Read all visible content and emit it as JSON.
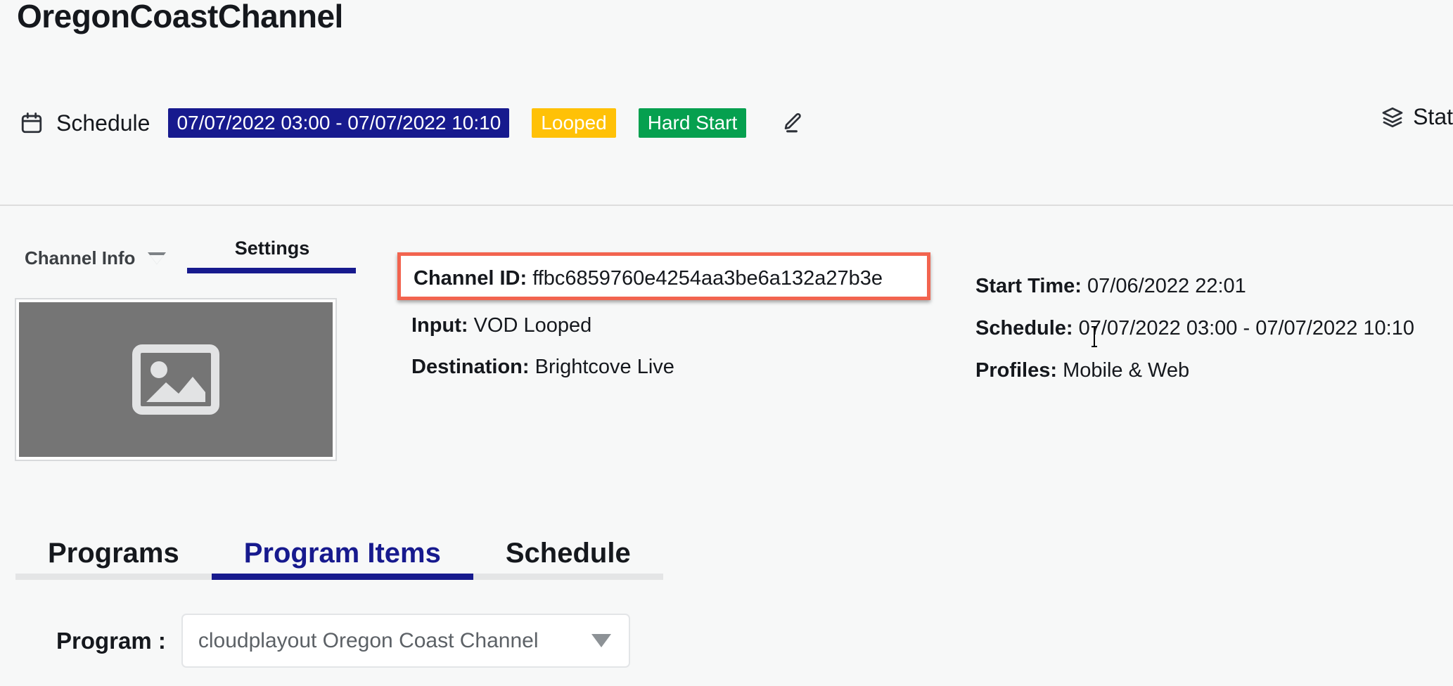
{
  "page": {
    "title": "OregonCoastChannel"
  },
  "header": {
    "calendar_icon": "calendar-icon",
    "schedule_label": "Schedule",
    "schedule_range": "07/07/2022 03:00 - 07/07/2022 10:10",
    "badge_looped": "Looped",
    "badge_hard_start": "Hard Start",
    "edit_icon": "pencil-icon",
    "layers_icon": "layers-icon",
    "status_label": "Stat",
    "colors": {
      "schedule_pill": "#171a8e",
      "looped_badge": "#ffc107",
      "hard_start_badge": "#06a04f"
    }
  },
  "subtabs": {
    "channel_info": "Channel Info",
    "channel_info_caret": "triangle-down-icon",
    "settings": "Settings",
    "active": "Settings"
  },
  "thumbnail": {
    "placeholder_icon": "image-placeholder-icon",
    "background": "#757575"
  },
  "settings": {
    "highlight_color": "#f2644f",
    "channel_id_label": "Channel ID:",
    "channel_id_value": "ffbc6859760e4254aa3be6a132a27b3e",
    "input_label": "Input:",
    "input_value": "VOD Looped",
    "destination_label": "Destination:",
    "destination_value": "Brightcove Live",
    "start_time_label": "Start Time:",
    "start_time_value": "07/06/2022 22:01",
    "schedule_label": "Schedule:",
    "schedule_value": "07/07/2022 03:00 - 07/07/2022 10:10",
    "profiles_label": "Profiles:",
    "profiles_value": "Mobile & Web"
  },
  "bottom_tabs": {
    "programs": "Programs",
    "program_items": "Program Items",
    "schedule": "Schedule",
    "active": "Program Items",
    "active_color": "#171a8e"
  },
  "program_selector": {
    "label": "Program :",
    "selected": "cloudplayout Oregon Coast Channel",
    "caret_icon": "caret-down-icon"
  }
}
